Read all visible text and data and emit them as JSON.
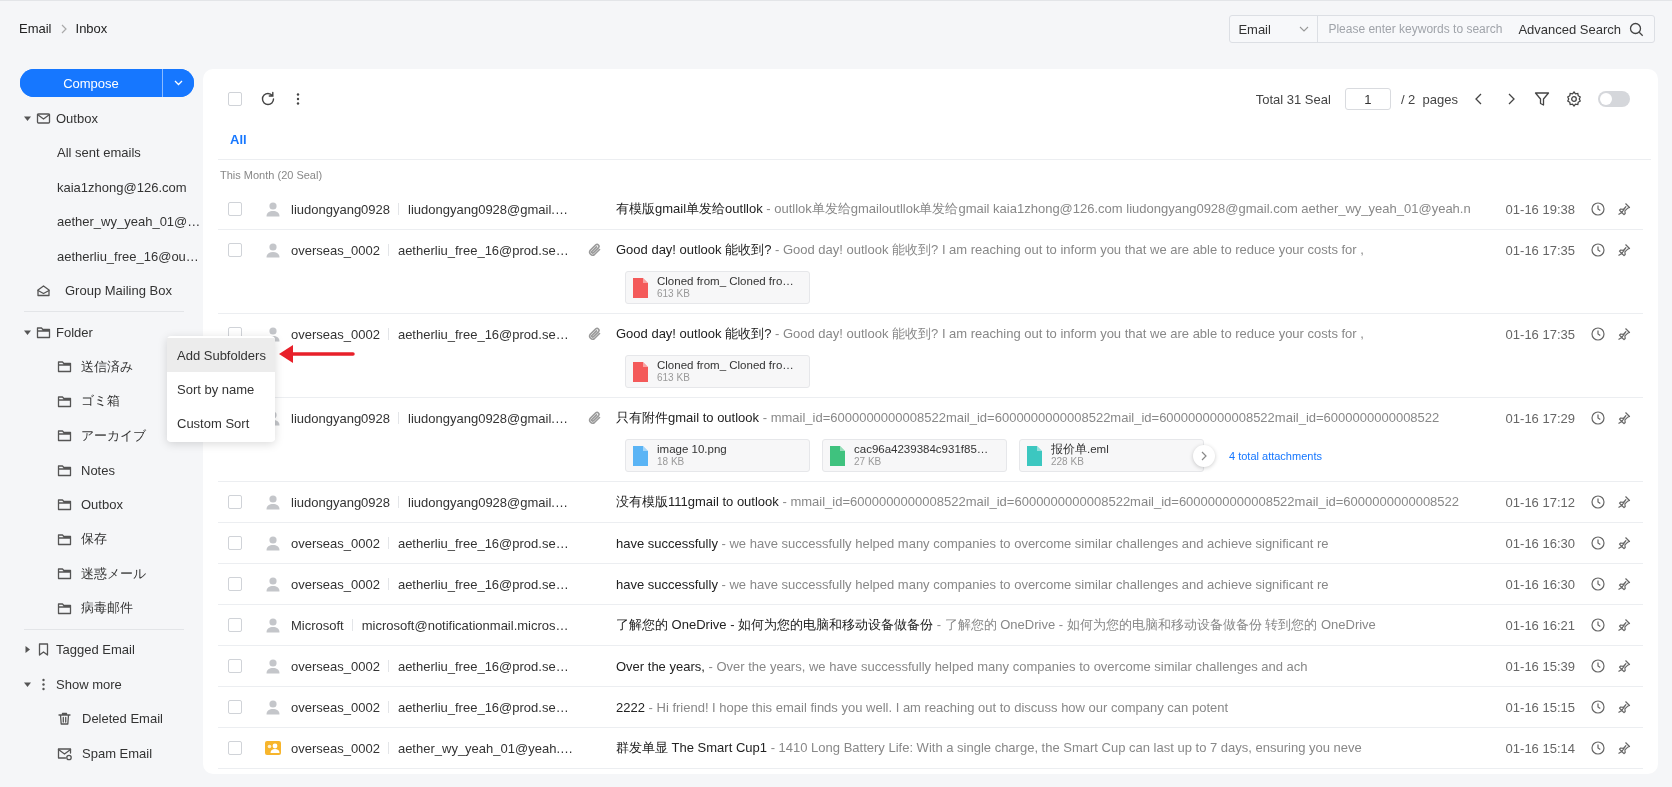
{
  "breadcrumb": [
    "Email",
    "Inbox"
  ],
  "search": {
    "scope": "Email",
    "placeholder": "Please enter keywords to search",
    "advanced": "Advanced Search"
  },
  "compose": {
    "label": "Compose"
  },
  "sidebar": {
    "sections": [
      {
        "items": [
          {
            "kind": "outbox",
            "label": "Outbox",
            "expanded": true,
            "children": [
              {
                "label": "All sent emails"
              },
              {
                "label": "kaia1zhong@126.com"
              },
              {
                "label": "aether_wy_yeah_01@…"
              },
              {
                "label": "aetherliu_free_16@ou…"
              }
            ]
          },
          {
            "kind": "group",
            "label": "Group Mailing Box"
          }
        ]
      },
      {
        "items": [
          {
            "kind": "folder",
            "label": "Folder",
            "expanded": true,
            "children": [
              {
                "kind": "folder",
                "label": "送信済み"
              },
              {
                "kind": "folder",
                "label": "ゴミ箱"
              },
              {
                "kind": "folder",
                "label": "アーカイブ"
              },
              {
                "kind": "folder",
                "label": "Notes"
              },
              {
                "kind": "folder",
                "label": "Outbox"
              },
              {
                "kind": "folder",
                "label": "保存"
              },
              {
                "kind": "folder",
                "label": "迷惑メール"
              },
              {
                "kind": "folder",
                "label": "病毒邮件"
              }
            ]
          }
        ]
      },
      {
        "items": [
          {
            "kind": "bookmark",
            "label": "Tagged Email",
            "expanded": false
          },
          {
            "kind": "more",
            "label": "Show more",
            "expanded": true,
            "children": [
              {
                "kind": "trash",
                "label": "Deleted Email"
              },
              {
                "kind": "spam",
                "label": "Spam Email"
              }
            ]
          }
        ]
      }
    ]
  },
  "context_menu": {
    "items": [
      {
        "label": "Add Subfolders",
        "selected": true
      },
      {
        "label": "Sort by name",
        "selected": false
      },
      {
        "label": "Custom Sort",
        "selected": false
      }
    ]
  },
  "toolbar": {
    "select_all": {
      "checked": false
    },
    "total": "Total 31 Seal",
    "page": "1",
    "pages": "/ 2  pages",
    "toggle": {
      "on": false
    }
  },
  "tabs": [
    {
      "label": "All",
      "selected": true
    }
  ],
  "group_heading": "This Month (20 Seal)",
  "mails": [
    {
      "checked": false,
      "avatar": {
        "kind": "person"
      },
      "sender": "liudongyang0928",
      "email": "liudongyang0928@gmail.…",
      "has_attachment": false,
      "subject": "有模版gmail单发给outllok",
      "preview": "- outllok单发给gmailoutllok单发给gmail kaia1zhong@126.com liudongyang0928@gmail.com aether_wy_yeah_01@yeah.n",
      "time": "01-16 19:38"
    },
    {
      "checked": false,
      "avatar": {
        "kind": "person"
      },
      "sender": "overseas_0002",
      "email": "aetherliu_free_16@prod.se…",
      "has_attachment": true,
      "subject": "Good day! outlook 能收到?",
      "preview": "- Good day! outlook 能收到?  I am reaching out to inform you that we are able to reduce your costs for  ,",
      "time": "01-16 17:35",
      "attachments": [
        {
          "kind": "pdf",
          "name": "Cloned from_ Cloned fro…",
          "size": "613 KB"
        }
      ]
    },
    {
      "checked": false,
      "avatar": {
        "kind": "person"
      },
      "sender": "overseas_0002",
      "email": "aetherliu_free_16@prod.se…",
      "has_attachment": true,
      "subject": "Good day! outlook 能收到?",
      "preview": "- Good day! outlook 能收到?  I am reaching out to inform you that we are able to reduce your costs for  ,",
      "time": "01-16 17:35",
      "attachments": [
        {
          "kind": "pdf",
          "name": "Cloned from_ Cloned fro…",
          "size": "613 KB"
        }
      ]
    },
    {
      "avatar": {
        "kind": "person"
      },
      "sender": "liudongyang0928",
      "email": "liudongyang0928@gmail.…",
      "has_attachment": true,
      "subject": "只有附件gmail to outlook",
      "preview": "- mmail_id=6000000000008522mail_id=6000000000008522mail_id=6000000000008522mail_id=6000000000008522",
      "time": "01-16 17:29",
      "attachments": [
        {
          "kind": "png",
          "name": "image 10.png",
          "size": "18 KB"
        },
        {
          "kind": "xls",
          "name": "cac96a4239384c931f85…",
          "size": "27 KB"
        },
        {
          "kind": "eml",
          "name": "报价单.eml",
          "size": "228 KB"
        }
      ],
      "more_attachments": true,
      "attachments_total": "4 total attachments"
    },
    {
      "checked": false,
      "avatar": {
        "kind": "person"
      },
      "sender": "liudongyang0928",
      "email": "liudongyang0928@gmail.…",
      "has_attachment": false,
      "subject": "没有模版111gmail to outlook",
      "preview": "- mmail_id=6000000000008522mail_id=6000000000008522mail_id=6000000000008522mail_id=6000000000008522",
      "time": "01-16 17:12"
    },
    {
      "checked": false,
      "avatar": {
        "kind": "person"
      },
      "sender": "overseas_0002",
      "email": "aetherliu_free_16@prod.se…",
      "has_attachment": false,
      "subject": "have successfully",
      "preview": "- we have successfully helped many companies to overcome similar challenges and achieve significant re",
      "time": "01-16 16:30"
    },
    {
      "checked": false,
      "avatar": {
        "kind": "person"
      },
      "sender": "overseas_0002",
      "email": "aetherliu_free_16@prod.se…",
      "has_attachment": false,
      "subject": "have successfully",
      "preview": "- we have successfully helped many companies to overcome similar challenges and achieve significant re",
      "time": "01-16 16:30"
    },
    {
      "checked": false,
      "avatar": {
        "kind": "person"
      },
      "sender": "Microsoft",
      "email": "microsoft@notificationmail.micros…",
      "has_attachment": false,
      "subject": "了解您的 OneDrive - 如何为您的电脑和移动设备做备份",
      "preview": "- 了解您的 OneDrive - 如何为您的电脑和移动设备做备份  转到您的 OneDrive",
      "time": "01-16 16:21"
    },
    {
      "checked": false,
      "avatar": {
        "kind": "person"
      },
      "sender": "overseas_0002",
      "email": "aetherliu_free_16@prod.se…",
      "has_attachment": false,
      "subject": "Over the years,",
      "preview": "- Over the years, we have successfully helped many companies to overcome similar challenges and ach",
      "time": "01-16 15:39"
    },
    {
      "checked": false,
      "avatar": {
        "kind": "person"
      },
      "sender": "overseas_0002",
      "email": "aetherliu_free_16@prod.se…",
      "has_attachment": false,
      "subject": "2222",
      "preview": "- Hi friend! I hope this email finds you well. I am reaching out to discuss how our company can potent",
      "time": "01-16 15:15"
    },
    {
      "checked": false,
      "avatar": {
        "kind": "group"
      },
      "sender": "overseas_0002",
      "email": "aether_wy_yeah_01@yeah.…",
      "has_attachment": false,
      "subject": "群发单显 The Smart Cup1",
      "preview": "- 1410 Long Battery Life: With a single charge, the Smart Cup can last up to 7 days, ensuring you neve",
      "time": "01-16 15:14"
    }
  ]
}
